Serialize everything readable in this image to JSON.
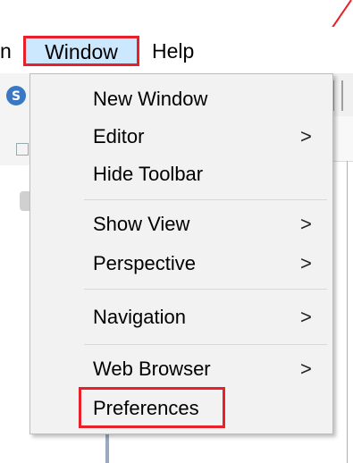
{
  "menubar": {
    "cut_label": "n",
    "window_label": "Window",
    "help_label": "Help"
  },
  "menu": {
    "items": [
      {
        "label": "New Window",
        "submenu": false
      },
      {
        "label": "Editor",
        "submenu": true
      },
      {
        "label": "Hide Toolbar",
        "submenu": false
      },
      {
        "label": "Show View",
        "submenu": true
      },
      {
        "label": "Perspective",
        "submenu": true
      },
      {
        "label": "Navigation",
        "submenu": true
      },
      {
        "label": "Web Browser",
        "submenu": true
      },
      {
        "label": "Preferences",
        "submenu": false
      }
    ],
    "arrow_glyph": ">"
  },
  "colors": {
    "highlight_outline": "#e8202a",
    "menu_selected_bg": "#cce8ff",
    "menu_bg": "#f2f2f2"
  },
  "icons": [
    "app-logo-icon",
    "chevron-right-icon"
  ]
}
